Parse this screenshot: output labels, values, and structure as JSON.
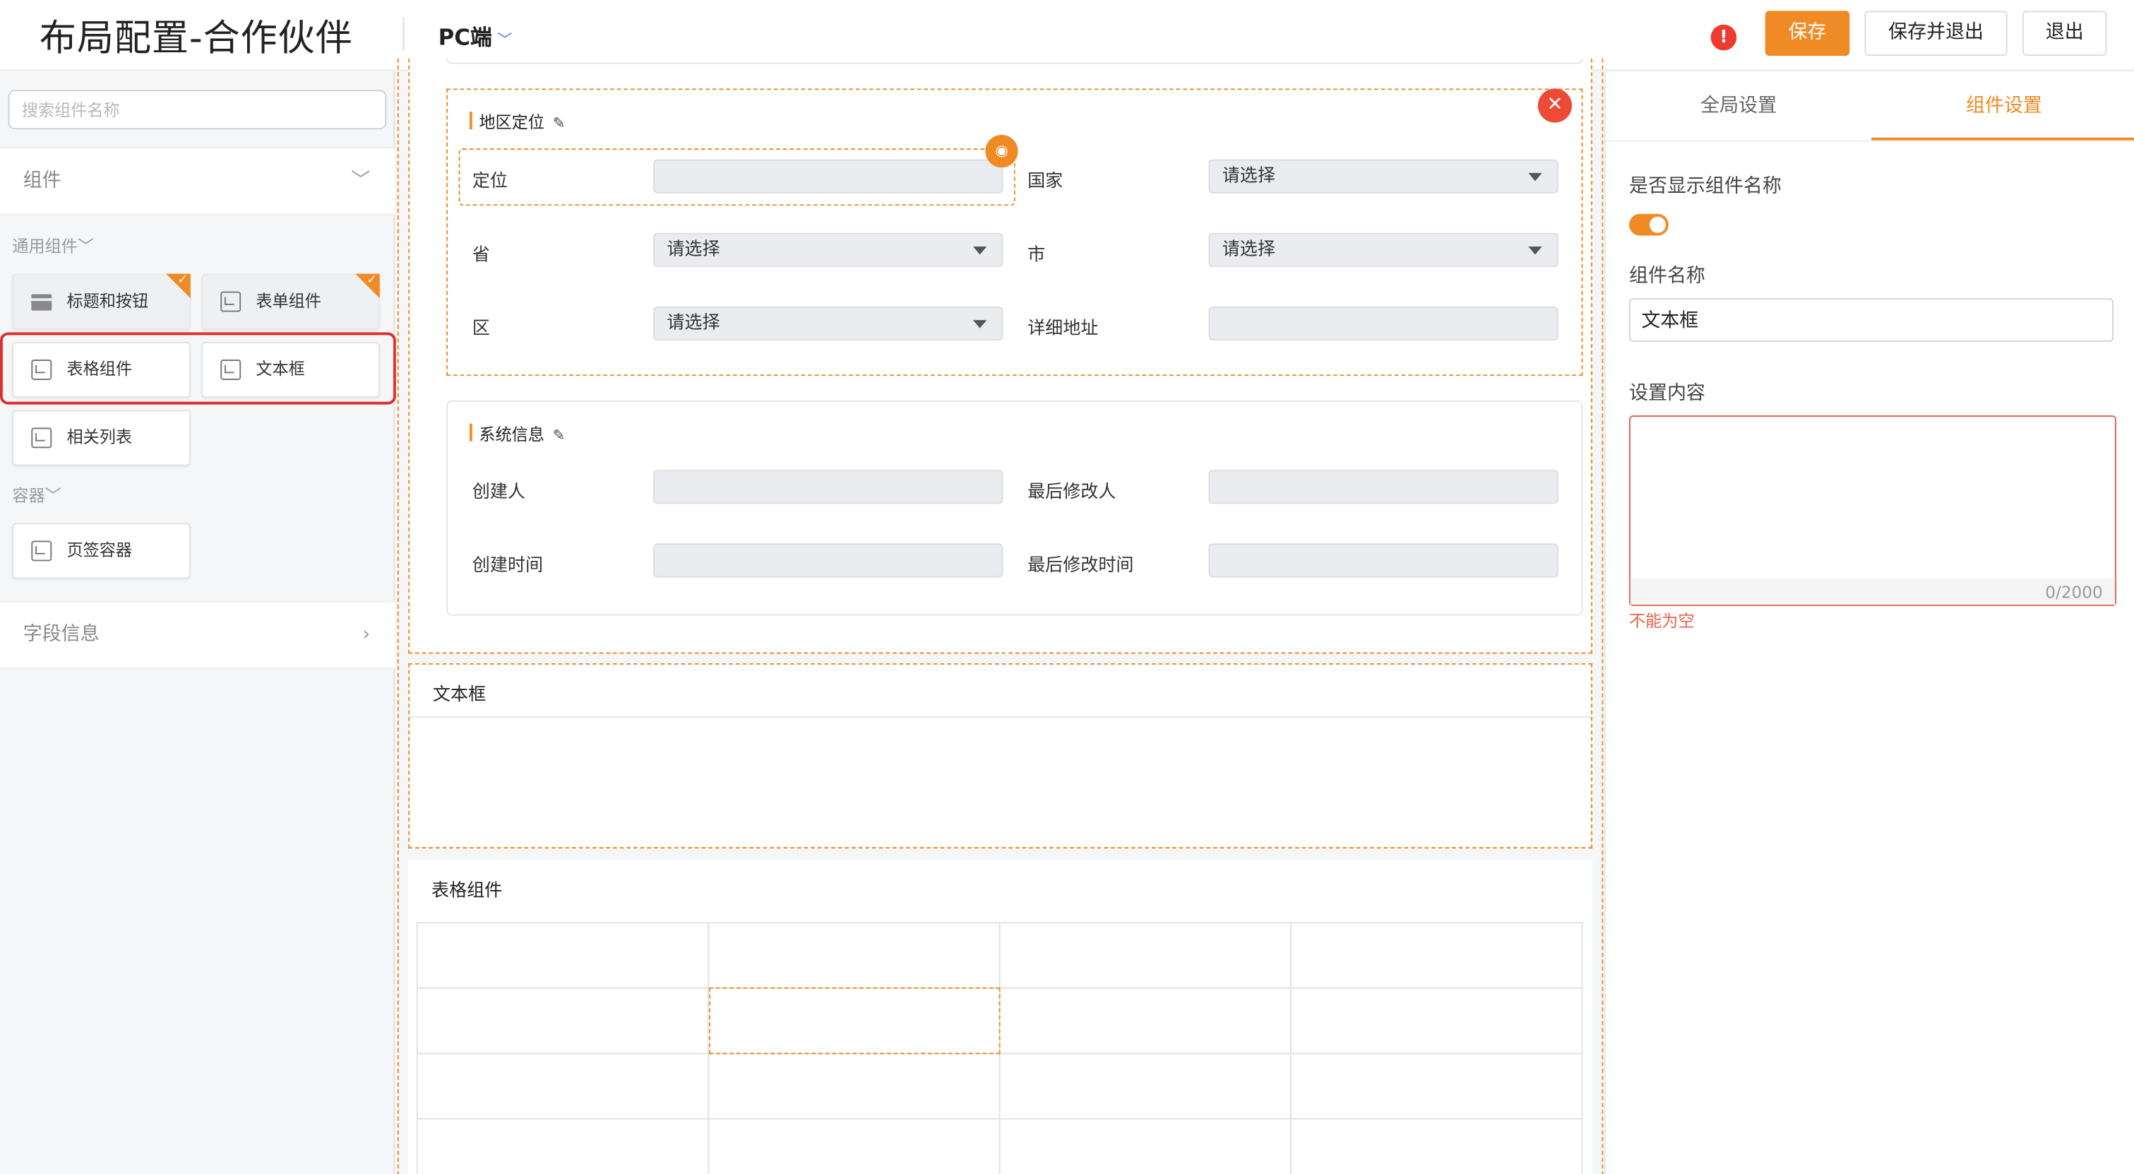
{
  "header": {
    "title": "布局配置-合作伙伴",
    "platform": "PC端",
    "warning_icon": "!",
    "buttons": {
      "save": "保存",
      "save_exit": "保存并退出",
      "exit": "退出"
    },
    "accent_color": "#f08a24"
  },
  "left_panel": {
    "search_placeholder": "搜索组件名称",
    "components_header": "组件",
    "groups": [
      {
        "label": "通用组件",
        "items": [
          {
            "label": "标题和按钮",
            "icon": "layout-header-icon",
            "used": true
          },
          {
            "label": "表单组件",
            "icon": "component-icon",
            "used": true
          },
          {
            "label": "表格组件",
            "icon": "component-icon",
            "used": false
          },
          {
            "label": "文本框",
            "icon": "component-icon",
            "used": false
          },
          {
            "label": "相关列表",
            "icon": "component-icon",
            "used": false
          }
        ]
      },
      {
        "label": "容器",
        "items": [
          {
            "label": "页签容器",
            "icon": "component-icon",
            "used": false
          }
        ]
      }
    ],
    "fields_header": "字段信息",
    "highlight_color": "#e02d2d"
  },
  "canvas": {
    "region_group": {
      "title": "地区定位",
      "fields": [
        {
          "label": "定位",
          "type": "input"
        },
        {
          "label": "国家",
          "type": "select",
          "value": "请选择"
        },
        {
          "label": "省",
          "type": "select",
          "value": "请选择"
        },
        {
          "label": "市",
          "type": "select",
          "value": "请选择"
        },
        {
          "label": "区",
          "type": "select",
          "value": "请选择"
        },
        {
          "label": "详细地址",
          "type": "input"
        }
      ]
    },
    "system_group": {
      "title": "系统信息",
      "fields": [
        {
          "label": "创建人"
        },
        {
          "label": "最后修改人"
        },
        {
          "label": "创建时间"
        },
        {
          "label": "最后修改时间"
        }
      ]
    },
    "textbox": {
      "title": "文本框"
    },
    "table": {
      "title": "表格组件",
      "columns": 4,
      "rows": 4
    }
  },
  "right_panel": {
    "tabs": {
      "global": "全局设置",
      "component": "组件设置"
    },
    "active_tab": "component",
    "show_name_label": "是否显示组件名称",
    "show_name_on": true,
    "name_label": "组件名称",
    "name_value": "文本框",
    "content_label": "设置内容",
    "content_value": "",
    "char_counter": "0/2000",
    "error": "不能为空",
    "error_color": "#e8604c"
  }
}
